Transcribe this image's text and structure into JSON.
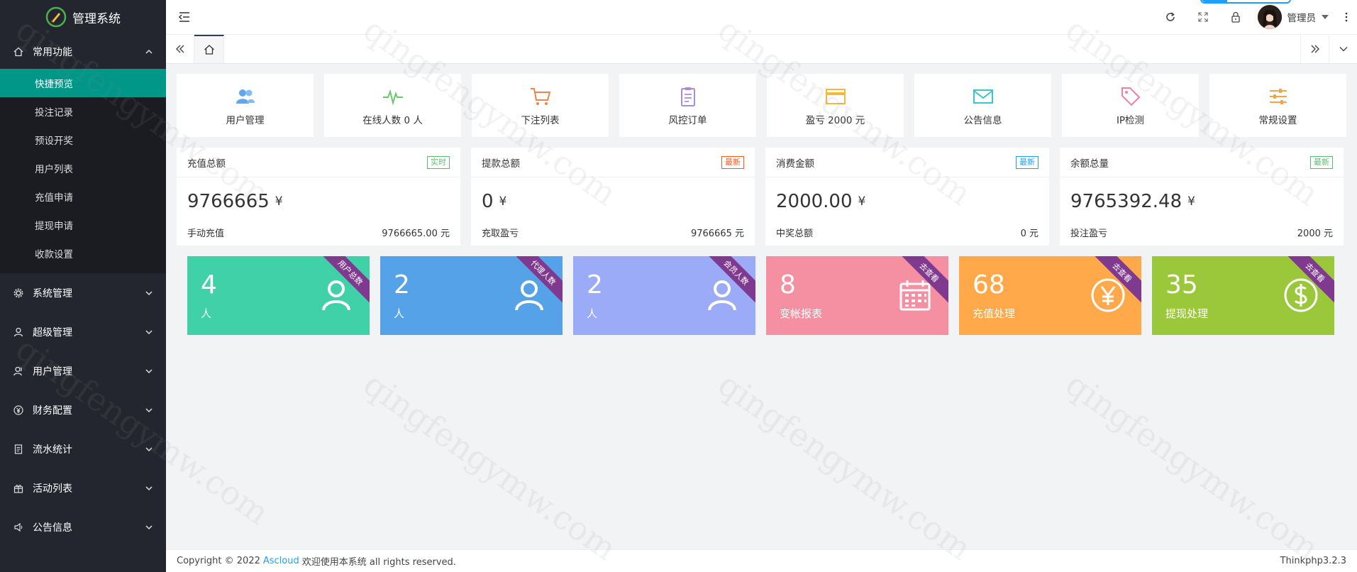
{
  "app": {
    "title": "管理系统"
  },
  "sidebar": {
    "groups": [
      {
        "label": "常用功能",
        "icon": "home-icon",
        "expanded": true,
        "items": [
          {
            "label": "快捷预览",
            "active": true
          },
          {
            "label": "投注记录"
          },
          {
            "label": "预设开奖"
          },
          {
            "label": "用户列表"
          },
          {
            "label": "充值申请"
          },
          {
            "label": "提现申请"
          },
          {
            "label": "收款设置"
          }
        ]
      },
      {
        "label": "系统管理",
        "icon": "gear-icon"
      },
      {
        "label": "超级管理",
        "icon": "user-icon"
      },
      {
        "label": "用户管理",
        "icon": "users-icon"
      },
      {
        "label": "财务配置",
        "icon": "yen-icon"
      },
      {
        "label": "流水统计",
        "icon": "document-icon"
      },
      {
        "label": "活动列表",
        "icon": "gift-icon"
      },
      {
        "label": "公告信息",
        "icon": "speaker-icon"
      }
    ]
  },
  "header": {
    "user": "管理员"
  },
  "quick": [
    {
      "label": "用户管理",
      "icon": "users-icon",
      "color": "#5ea6f0"
    },
    {
      "label": "在线人数 0 人",
      "icon": "pulse-icon",
      "color": "#6cc66c"
    },
    {
      "label": "下注列表",
      "icon": "cart-icon",
      "color": "#f0834a"
    },
    {
      "label": "风控订单",
      "icon": "clipboard-icon",
      "color": "#a98bd8"
    },
    {
      "label": "盈亏 2000 元",
      "icon": "card-icon",
      "color": "#f5b83a"
    },
    {
      "label": "公告信息",
      "icon": "mail-icon",
      "color": "#3cc7c7"
    },
    {
      "label": "IP检测",
      "icon": "tag-icon",
      "color": "#f07fa8"
    },
    {
      "label": "常规设置",
      "icon": "sliders-icon",
      "color": "#f0a64a"
    }
  ],
  "stats": [
    {
      "title": "充值总额",
      "badge": "实时",
      "value": "9766665",
      "currency": "¥",
      "foot_label": "手动充值",
      "foot_value": "9766665.00 元"
    },
    {
      "title": "提款总额",
      "badge": "最新",
      "value": "0",
      "currency": "¥",
      "foot_label": "充取盈亏",
      "foot_value": "9766665 元"
    },
    {
      "title": "消费金额",
      "badge": "最新",
      "value": "2000.00",
      "currency": "¥",
      "foot_label": "中奖总额",
      "foot_value": "0 元"
    },
    {
      "title": "余额总量",
      "badge": "最新",
      "value": "9765392.48",
      "currency": "¥",
      "foot_label": "投注盈亏",
      "foot_value": "2000 元"
    }
  ],
  "cards": [
    {
      "num": "4",
      "unit": "人",
      "ribbon": "用户总数",
      "icon": "user-icon"
    },
    {
      "num": "2",
      "unit": "人",
      "ribbon": "代理人数",
      "icon": "user-icon"
    },
    {
      "num": "2",
      "unit": "人",
      "ribbon": "会员人数",
      "icon": "user-icon"
    },
    {
      "num": "8",
      "unit": "变帐报表",
      "ribbon": "去查看",
      "icon": "calendar-icon"
    },
    {
      "num": "68",
      "unit": "充值处理",
      "ribbon": "去查看",
      "icon": "yen-circle-icon"
    },
    {
      "num": "35",
      "unit": "提现处理",
      "ribbon": "去查看",
      "icon": "dollar-circle-icon"
    }
  ],
  "footer": {
    "copyright": "Copyright © 2022",
    "link": "Ascloud",
    "text": "欢迎使用本系统 all rights reserved.",
    "version": "Thinkphp3.2.3"
  },
  "watermark": "qingfengymw.com"
}
